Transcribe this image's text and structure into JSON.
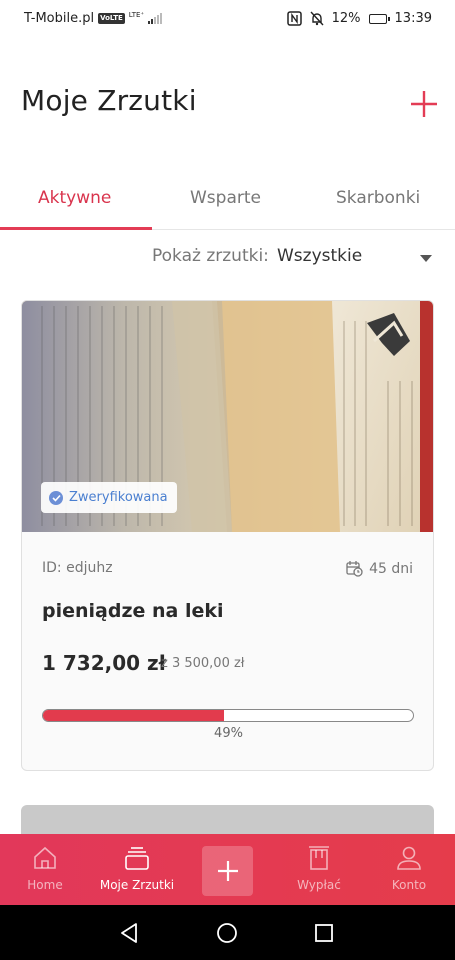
{
  "status_bar": {
    "carrier": "T-Mobile.pl",
    "volte": "VoLTE",
    "lte": "LTE⁺",
    "battery": "12%",
    "time": "13:39"
  },
  "header": {
    "title": "Moje Zrzutki",
    "add_icon": "plus-icon"
  },
  "tabs": [
    {
      "label": "Aktywne",
      "active": true
    },
    {
      "label": "Wsparte",
      "active": false
    },
    {
      "label": "Skarbonki",
      "active": false
    }
  ],
  "filter": {
    "label": "Pokaż zrzutki:",
    "value": "Wszystkie"
  },
  "campaign": {
    "verified_label": "Zweryfikowana",
    "id": "ID: edjuhz",
    "days_left": "45 dni",
    "title": "pieniądze na leki",
    "amount": "1 732,00 zł",
    "goal": "z 3 500,00 zł",
    "progress": 0.49,
    "progress_label": "49%"
  },
  "bottom_nav": [
    {
      "label": "Home",
      "icon": "home-icon",
      "active": false
    },
    {
      "label": "Moje Zrzutki",
      "icon": "stack-icon",
      "active": true
    },
    {
      "label": "",
      "icon": "plus-icon",
      "active": false
    },
    {
      "label": "Wypłać",
      "icon": "wallet-icon",
      "active": false
    },
    {
      "label": "Konto",
      "icon": "user-icon",
      "active": false
    }
  ],
  "colors": {
    "accent": "#e33c55",
    "nav_bg": "#e53c4b",
    "verified": "#4a7fd0"
  }
}
